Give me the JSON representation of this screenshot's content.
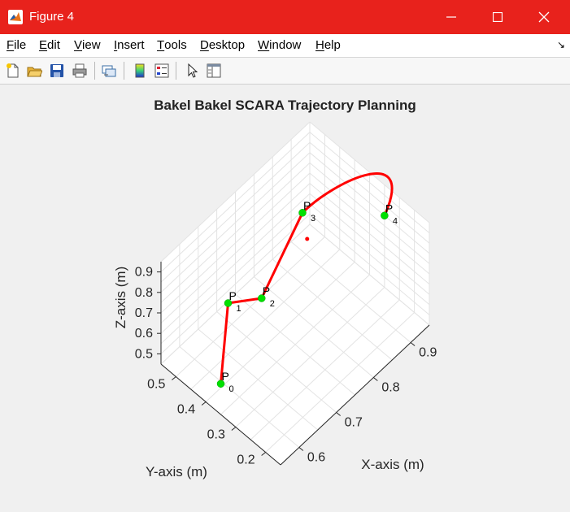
{
  "window": {
    "title": "Figure 4"
  },
  "menu": [
    "File",
    "Edit",
    "View",
    "Insert",
    "Tools",
    "Desktop",
    "Window",
    "Help"
  ],
  "toolbar_icons": [
    "new-figure-icon",
    "open-file-icon",
    "save-icon",
    "print-icon",
    "link-icon",
    "colorbar-icon",
    "legend-icon",
    "pointer-icon",
    "property-editor-icon"
  ],
  "plot": {
    "title": "Bakel Bakel SCARA Trajectory Planning",
    "xlabel": "X-axis (m)",
    "ylabel": "Y-axis (m)",
    "zlabel": "Z-axis (m)"
  },
  "chart_data": {
    "type": "scatter",
    "title": "Bakel Bakel SCARA Trajectory Planning",
    "xlabel": "X-axis (m)",
    "ylabel": "Y-axis (m)",
    "zlabel": "Z-axis (m)",
    "x_ticks": [
      "0.6",
      "0.7",
      "0.8",
      "0.9"
    ],
    "y_ticks": [
      "0.2",
      "0.3",
      "0.4",
      "0.5"
    ],
    "z_ticks": [
      "0.5",
      "0.6",
      "0.7",
      "0.8",
      "0.9"
    ],
    "grid": true,
    "colors": {
      "path": "#ff0000",
      "waypoint": "#00e000",
      "base": "#ff0000"
    },
    "waypoints": [
      {
        "name": "P",
        "index": "0",
        "x": 0.55,
        "y": 0.35,
        "z": 0.6
      },
      {
        "name": "P",
        "index": "1",
        "x": 0.65,
        "y": 0.45,
        "z": 0.7
      },
      {
        "name": "P",
        "index": "2",
        "x": 0.7,
        "y": 0.4,
        "z": 0.7
      },
      {
        "name": "P",
        "index": "3",
        "x": 0.85,
        "y": 0.45,
        "z": 0.8
      },
      {
        "name": "P",
        "index": "4",
        "x": 0.95,
        "y": 0.3,
        "z": 0.8
      }
    ]
  }
}
